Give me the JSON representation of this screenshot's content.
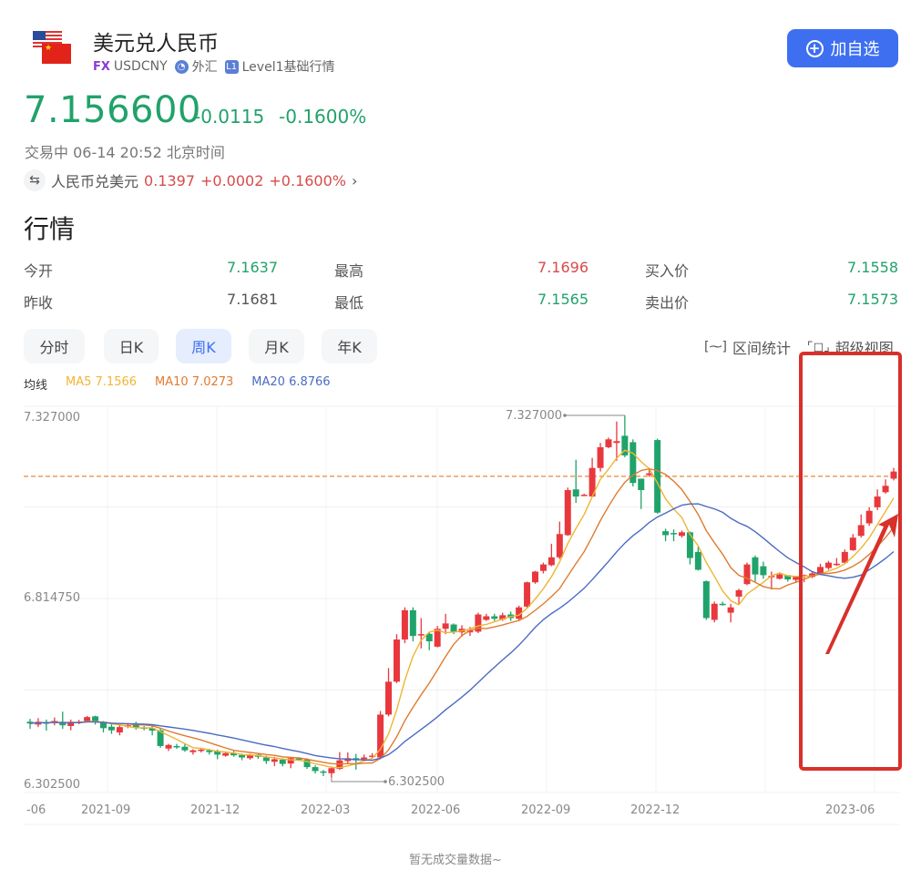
{
  "header": {
    "title": "美元兑人民币",
    "badge_fx": "FX",
    "symbol": "USDCNY",
    "category": "外汇",
    "level_icon": "L1",
    "level": "Level1基础行情",
    "add_button": "加自选"
  },
  "price": {
    "last": "7.156600",
    "change": "-0.0115",
    "change_pct": "-0.1600%",
    "status": "交易中 06-14 20:52 北京时间",
    "reverse_label": "人民币兑美元",
    "reverse_price": "0.1397",
    "reverse_change": "+0.0002",
    "reverse_change_pct": "+0.1600%"
  },
  "section_title": "行情",
  "quote": {
    "open_label": "今开",
    "open": "7.1637",
    "prev_label": "昨收",
    "prev": "7.1681",
    "high_label": "最高",
    "high": "7.1696",
    "low_label": "最低",
    "low": "7.1565",
    "bid_label": "买入价",
    "bid": "7.1558",
    "ask_label": "卖出价",
    "ask": "7.1573"
  },
  "tabs": [
    {
      "label": "分时",
      "active": false
    },
    {
      "label": "日K",
      "active": false
    },
    {
      "label": "周K",
      "active": true
    },
    {
      "label": "月K",
      "active": false
    },
    {
      "label": "年K",
      "active": false
    }
  ],
  "tools": {
    "range_stats": "区间统计",
    "super_view": "超级视图"
  },
  "ma": {
    "label": "均线",
    "ma5": "MA5 7.1566",
    "ma10": "MA10 7.0273",
    "ma20": "MA20 6.8766"
  },
  "colors": {
    "up": "#e8383d",
    "down": "#1fa36b",
    "ma5": "#f0b531",
    "ma10": "#e07b2f",
    "ma20": "#4a6bc4",
    "accent": "#3d6ff0",
    "annotation": "#d8302a"
  },
  "footer": {
    "no_volume": "暂无成交量数据~"
  },
  "chart_data": {
    "type": "candlestick",
    "title": "USDCNY 周K",
    "ylim": [
      6.3025,
      7.327
    ],
    "ytick_labels": [
      "7.327000",
      "6.814750",
      "6.302500"
    ],
    "xtick_labels": [
      "-06",
      "2021-09",
      "2021-12",
      "2022-03",
      "2022-06",
      "2022-09",
      "2022-12",
      "2023-06"
    ],
    "max_marker": "7.327000",
    "min_marker": "6.302500",
    "current_price_line": 7.1566,
    "legend": [
      "MA5 7.1566",
      "MA10 7.0273",
      "MA20 6.8766"
    ],
    "candles": [
      [
        6.47,
        6.465,
        6.478,
        6.45
      ],
      [
        6.462,
        6.47,
        6.48,
        6.455
      ],
      [
        6.468,
        6.467,
        6.476,
        6.445
      ],
      [
        6.466,
        6.472,
        6.482,
        6.46
      ],
      [
        6.47,
        6.46,
        6.498,
        6.45
      ],
      [
        6.458,
        6.47,
        6.476,
        6.446
      ],
      [
        6.469,
        6.47,
        6.475,
        6.463
      ],
      [
        6.472,
        6.483,
        6.486,
        6.468
      ],
      [
        6.485,
        6.47,
        6.487,
        6.462
      ],
      [
        6.47,
        6.452,
        6.472,
        6.44
      ],
      [
        6.456,
        6.446,
        6.464,
        6.436
      ],
      [
        6.44,
        6.455,
        6.465,
        6.432
      ],
      [
        6.456,
        6.46,
        6.466,
        6.452
      ],
      [
        6.462,
        6.453,
        6.47,
        6.448
      ],
      [
        6.454,
        6.452,
        6.458,
        6.446
      ],
      [
        6.452,
        6.445,
        6.46,
        6.432
      ],
      [
        6.446,
        6.402,
        6.45,
        6.397
      ],
      [
        6.395,
        6.405,
        6.408,
        6.388
      ],
      [
        6.402,
        6.4,
        6.408,
        6.394
      ],
      [
        6.4,
        6.39,
        6.41,
        6.386
      ],
      [
        6.385,
        6.39,
        6.393,
        6.378
      ],
      [
        6.389,
        6.392,
        6.396,
        6.384
      ],
      [
        6.39,
        6.385,
        6.394,
        6.378
      ],
      [
        6.388,
        6.378,
        6.392,
        6.365
      ],
      [
        6.375,
        6.382,
        6.386,
        6.372
      ],
      [
        6.383,
        6.376,
        6.388,
        6.372
      ],
      [
        6.377,
        6.37,
        6.381,
        6.362
      ],
      [
        6.368,
        6.378,
        6.38,
        6.364
      ],
      [
        6.378,
        6.372,
        6.382,
        6.366
      ],
      [
        6.37,
        6.36,
        6.375,
        6.352
      ],
      [
        6.358,
        6.365,
        6.372,
        6.346
      ],
      [
        6.364,
        6.352,
        6.368,
        6.345
      ],
      [
        6.353,
        6.368,
        6.372,
        6.34
      ],
      [
        6.367,
        6.366,
        6.37,
        6.36
      ],
      [
        6.364,
        6.343,
        6.368,
        6.338
      ],
      [
        6.343,
        6.332,
        6.348,
        6.325
      ],
      [
        6.331,
        6.33,
        6.335,
        6.318
      ],
      [
        6.326,
        6.34,
        6.345,
        6.314
      ],
      [
        6.338,
        6.362,
        6.385,
        6.335
      ],
      [
        6.36,
        6.368,
        6.384,
        6.352
      ],
      [
        6.368,
        6.362,
        6.38,
        6.336
      ],
      [
        6.365,
        6.37,
        6.378,
        6.36
      ],
      [
        6.372,
        6.375,
        6.382,
        6.368
      ],
      [
        6.37,
        6.49,
        6.5,
        6.365
      ],
      [
        6.49,
        6.582,
        6.62,
        6.485
      ],
      [
        6.582,
        6.7,
        6.715,
        6.578
      ],
      [
        6.7,
        6.782,
        6.79,
        6.69
      ],
      [
        6.782,
        6.71,
        6.79,
        6.695
      ],
      [
        6.712,
        6.715,
        6.76,
        6.675
      ],
      [
        6.716,
        6.695,
        6.722,
        6.67
      ],
      [
        6.68,
        6.73,
        6.738,
        6.678
      ],
      [
        6.73,
        6.745,
        6.772,
        6.715
      ],
      [
        6.742,
        6.72,
        6.745,
        6.715
      ],
      [
        6.72,
        6.73,
        6.74,
        6.708
      ],
      [
        6.72,
        6.725,
        6.735,
        6.71
      ],
      [
        6.722,
        6.77,
        6.775,
        6.718
      ],
      [
        6.755,
        6.765,
        6.772,
        6.752
      ],
      [
        6.765,
        6.758,
        6.772,
        6.752
      ],
      [
        6.756,
        6.768,
        6.775,
        6.752
      ],
      [
        6.77,
        6.76,
        6.778,
        6.752
      ],
      [
        6.758,
        6.79,
        6.795,
        6.752
      ],
      [
        6.792,
        6.86,
        6.862,
        6.788
      ],
      [
        6.86,
        6.89,
        6.892,
        6.856
      ],
      [
        6.892,
        6.91,
        6.915,
        6.885
      ],
      [
        6.908,
        6.93,
        6.968,
        6.905
      ],
      [
        6.93,
        6.995,
        7.03,
        6.925
      ],
      [
        6.992,
        7.118,
        7.125,
        6.99
      ],
      [
        7.12,
        7.1,
        7.203,
        7.082
      ],
      [
        7.105,
        7.105,
        7.108,
        7.104
      ],
      [
        7.1,
        7.18,
        7.208,
        7.098
      ],
      [
        7.18,
        7.238,
        7.25,
        7.17
      ],
      [
        7.238,
        7.26,
        7.265,
        7.235
      ],
      [
        7.25,
        7.255,
        7.31,
        7.2
      ],
      [
        7.27,
        7.215,
        7.327,
        7.21
      ],
      [
        7.252,
        7.138,
        7.26,
        7.128
      ],
      [
        7.15,
        7.118,
        7.148,
        7.065
      ],
      [
        7.16,
        7.165,
        7.175,
        7.155
      ],
      [
        7.258,
        7.055,
        7.262,
        7.052
      ],
      [
        7.003,
        6.992,
        7.01,
        6.975
      ],
      [
        6.998,
        6.995,
        7.008,
        6.975
      ],
      [
        6.99,
        7.0,
        7.005,
        6.985
      ],
      [
        7.0,
        6.928,
        7.002,
        6.91
      ],
      [
        6.945,
        6.895,
        6.96,
        6.893
      ],
      [
        6.863,
        6.76,
        6.865,
        6.755
      ],
      [
        6.755,
        6.8,
        6.806,
        6.748
      ],
      [
        6.8,
        6.798,
        6.806,
        6.795
      ],
      [
        6.775,
        6.79,
        6.8,
        6.748
      ],
      [
        6.82,
        6.838,
        6.842,
        6.8
      ],
      [
        6.855,
        6.91,
        6.915,
        6.852
      ],
      [
        6.93,
        6.882,
        6.935,
        6.86
      ],
      [
        6.905,
        6.88,
        6.918,
        6.87
      ],
      [
        6.878,
        6.878,
        6.89,
        6.84
      ],
      [
        6.87,
        6.882,
        6.885,
        6.868
      ],
      [
        6.88,
        6.868,
        6.88,
        6.862
      ],
      [
        6.867,
        6.875,
        6.878,
        6.86
      ],
      [
        6.876,
        6.88,
        6.882,
        6.86
      ],
      [
        6.875,
        6.885,
        6.89,
        6.872
      ],
      [
        6.885,
        6.903,
        6.912,
        6.88
      ],
      [
        6.9,
        6.915,
        6.92,
        6.895
      ],
      [
        6.91,
        6.912,
        6.928,
        6.906
      ],
      [
        6.915,
        6.945,
        6.952,
        6.912
      ],
      [
        6.95,
        6.985,
        6.995,
        6.948
      ],
      [
        6.99,
        7.02,
        7.05,
        6.985
      ],
      [
        7.025,
        7.06,
        7.07,
        7.018
      ],
      [
        7.07,
        7.1,
        7.12,
        7.062
      ],
      [
        7.112,
        7.13,
        7.148,
        7.108
      ],
      [
        7.15,
        7.17,
        7.18,
        7.145
      ]
    ]
  }
}
